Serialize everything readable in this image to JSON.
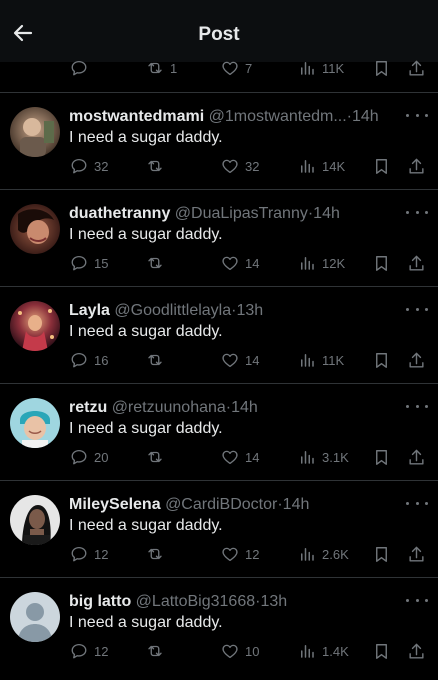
{
  "header": {
    "title": "Post",
    "back_icon": "arrow-left-icon"
  },
  "top_stats": {
    "replies": "",
    "reposts": "1",
    "likes": "7",
    "views": "11K"
  },
  "replies": [
    {
      "name": "mostwantedmami",
      "handle": "@1mostwantedm...",
      "sep": "·",
      "time": "14h",
      "text": "I need a sugar daddy.",
      "stats": {
        "replies": "32",
        "reposts": "",
        "likes": "32",
        "views": "14K"
      }
    },
    {
      "name": "duathetranny",
      "handle": "@DuaLipasTranny",
      "sep": "·",
      "time": "14h",
      "text": "I need a sugar daddy.",
      "stats": {
        "replies": "15",
        "reposts": "",
        "likes": "14",
        "views": "12K"
      }
    },
    {
      "name": "Layla",
      "handle": "@Goodlittlelayla",
      "sep": "·",
      "time": "13h",
      "text": "I need a sugar daddy.",
      "stats": {
        "replies": "16",
        "reposts": "",
        "likes": "14",
        "views": "11K"
      }
    },
    {
      "name": "retzu",
      "handle": "@retzuunohana",
      "sep": "·",
      "time": "14h",
      "text": "I need a sugar daddy.",
      "stats": {
        "replies": "20",
        "reposts": "",
        "likes": "14",
        "views": "3.1K"
      }
    },
    {
      "name": "MileySelena",
      "handle": "@CardiBDoctor",
      "sep": "·",
      "time": "14h",
      "text": "I need a sugar daddy.",
      "stats": {
        "replies": "12",
        "reposts": "",
        "likes": "12",
        "views": "2.6K"
      }
    },
    {
      "name": "big latto",
      "handle": "@LattoBig31668",
      "sep": "·",
      "time": "13h",
      "text": "I need a sugar daddy.",
      "stats": {
        "replies": "12",
        "reposts": "",
        "likes": "10",
        "views": "1.4K"
      }
    }
  ]
}
